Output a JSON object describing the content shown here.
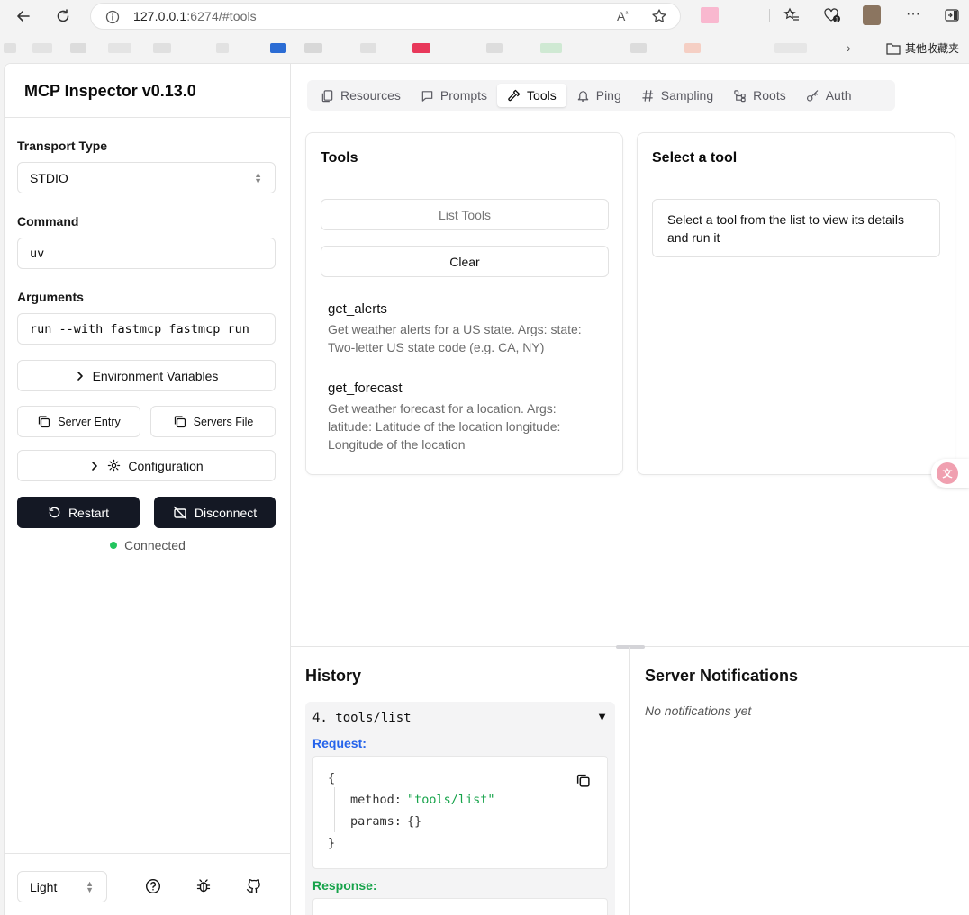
{
  "browser": {
    "url_host": "127.0.0.1",
    "url_rest": ":6274/#tools",
    "bookmarks_other": "其他收藏夹"
  },
  "sidebar": {
    "title": "MCP Inspector v0.13.0",
    "transport_label": "Transport Type",
    "transport_value": "STDIO",
    "command_label": "Command",
    "command_value": "uv",
    "arguments_label": "Arguments",
    "arguments_value": "run --with fastmcp fastmcp run",
    "env_vars": "Environment Variables",
    "server_entry": "Server Entry",
    "servers_file": "Servers File",
    "configuration": "Configuration",
    "restart": "Restart",
    "disconnect": "Disconnect",
    "status": "Connected",
    "theme": "Light"
  },
  "tabs": [
    {
      "label": "Resources",
      "icon": "resources-icon"
    },
    {
      "label": "Prompts",
      "icon": "prompts-icon"
    },
    {
      "label": "Tools",
      "icon": "hammer-icon",
      "active": true
    },
    {
      "label": "Ping",
      "icon": "bell-icon"
    },
    {
      "label": "Sampling",
      "icon": "hash-icon"
    },
    {
      "label": "Roots",
      "icon": "tree-icon"
    },
    {
      "label": "Auth",
      "icon": "key-icon"
    }
  ],
  "tools_panel": {
    "title": "Tools",
    "list_button": "List Tools",
    "clear_button": "Clear",
    "items": [
      {
        "name": "get_alerts",
        "description": "Get weather alerts for a US state. Args: state: Two-letter US state code (e.g. CA, NY)"
      },
      {
        "name": "get_forecast",
        "description": "Get weather forecast for a location. Args: latitude: Latitude of the location longitude: Longitude of the location"
      }
    ]
  },
  "detail_panel": {
    "title": "Select a tool",
    "hint": "Select a tool from the list to view its details and run it"
  },
  "history": {
    "title": "History",
    "entry": "4. tools/list",
    "toggle": "▼",
    "request_label": "Request:",
    "response_label": "Response:",
    "code": {
      "open": "{",
      "method_key": "method:",
      "method_val": "\"tools/list\"",
      "params_key": "params:",
      "params_val": "{}",
      "close": "}"
    }
  },
  "notifications": {
    "title": "Server Notifications",
    "empty": "No notifications yet"
  },
  "colors": {
    "connected": "#22c55e",
    "request": "#2563eb",
    "response": "#16a34a",
    "dark_button": "#141824"
  }
}
